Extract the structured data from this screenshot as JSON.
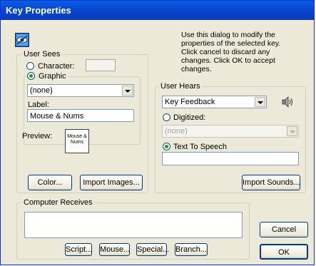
{
  "window": {
    "title": "Key Properties"
  },
  "info_text": [
    "Use this dialog to modify the",
    "properties of the selected key.",
    "Click cancel to discard any",
    "changes. Click OK to accept",
    "changes."
  ],
  "user_sees": {
    "group_label": "User Sees",
    "character_label": "Character:",
    "character_value": "",
    "graphic_label": "Graphic",
    "graphic_selected": "(none)",
    "label_caption": "Label:",
    "label_value": "Mouse & Nums",
    "preview_caption": "Preview:",
    "preview_text": "Mouse & Nums",
    "color_button": "Color...",
    "import_images_button": "Import Images...",
    "selected_mode": "graphic"
  },
  "user_hears": {
    "group_label": "User Hears",
    "feedback_selected": "Key Feedback",
    "digitized_label": "Digitized:",
    "digitized_selected": "(none)",
    "tts_label": "Text To Speech",
    "tts_value": "",
    "import_sounds_button": "Import Sounds...",
    "selected_mode": "text_to_speech"
  },
  "computer_receives": {
    "group_label": "Computer Receives",
    "value": "",
    "buttons": {
      "script": "Script...",
      "mouse": "Mouse...",
      "special": "Special...",
      "branch": "Branch..."
    }
  },
  "dialog_buttons": {
    "cancel": "Cancel",
    "ok": "OK"
  },
  "icons": {
    "app_icon": "eye-key-icon",
    "speaker_icon": "speaker-icon"
  },
  "colors": {
    "title_bar": "#0a5fe0",
    "dialog_bg": "#ece9d8",
    "button_border": "#003c74"
  }
}
